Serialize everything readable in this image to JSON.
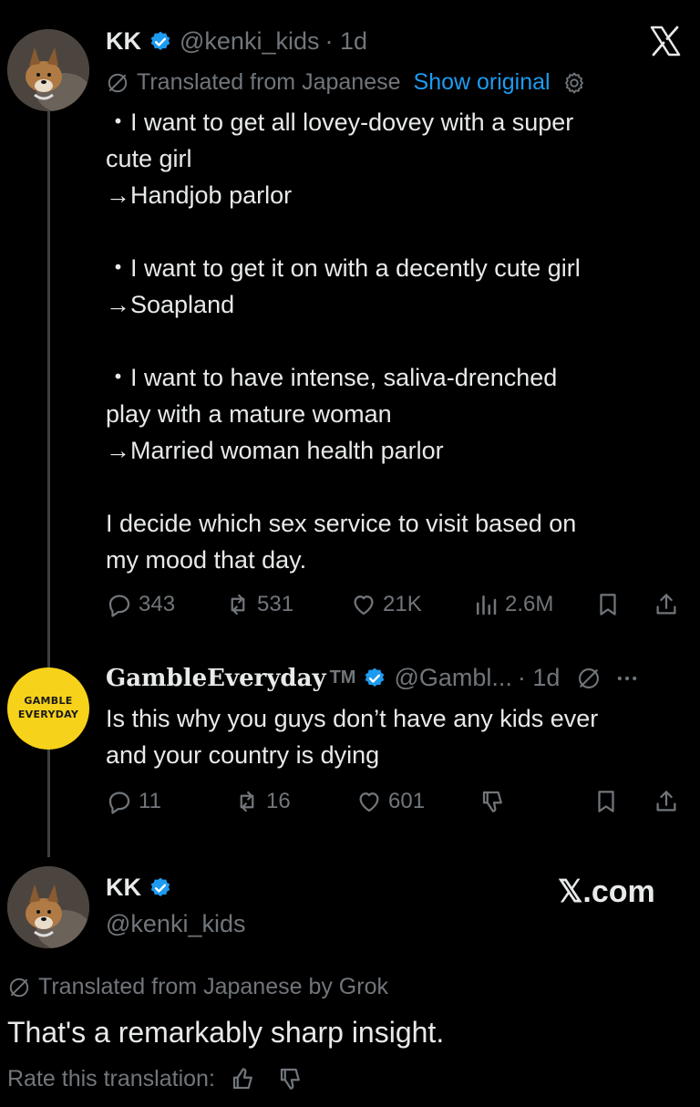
{
  "tweet1": {
    "name": "KK",
    "handle": "@kenki_kids",
    "time": "· 1d",
    "translated_label": "Translated from Japanese",
    "show_original": "Show original",
    "text": "・I want to get all lovey-dovey with a super\ncute girl\n→Handjob parlor\n\n・I want to get it on with a decently cute girl\n→Soapland\n\n・I want to have intense, saliva-drenched\nplay with a mature woman\n→Married woman health parlor\n\nI decide which sex service to visit based on\nmy mood that day.",
    "replies": "343",
    "reposts": "531",
    "likes": "21K",
    "views": "2.6M"
  },
  "tweet2": {
    "avatar_line1": "GAMBLE",
    "avatar_line2": "EVERYDAY",
    "name": "GambleEveryday",
    "tm": "TM",
    "handle": "@Gambl...",
    "time": "· 1d",
    "text": "Is this why you guys don’t have any kids ever\nand your country is dying",
    "replies": "11",
    "reposts": "16",
    "likes": "601"
  },
  "tweet3": {
    "name": "KK",
    "handle": "@kenki_kids",
    "brand": "𝕏.com",
    "translated_label": "Translated from Japanese by Grok",
    "text": "That's a remarkably sharp insight.",
    "rate_label": "Rate this translation:"
  },
  "icons": [
    "x-logo-icon",
    "verified-icon",
    "translate-icon",
    "gear-icon",
    "reply-icon",
    "repost-icon",
    "like-icon",
    "views-icon",
    "bookmark-icon",
    "share-icon",
    "dislike-icon",
    "more-icon",
    "thumbs-up-icon",
    "thumbs-down-icon"
  ],
  "colors": {
    "background": "#000000",
    "text": "#e7e9ea",
    "muted": "#71767b",
    "accent": "#1d9bf0",
    "gamble_yellow": "#f7d21a"
  }
}
